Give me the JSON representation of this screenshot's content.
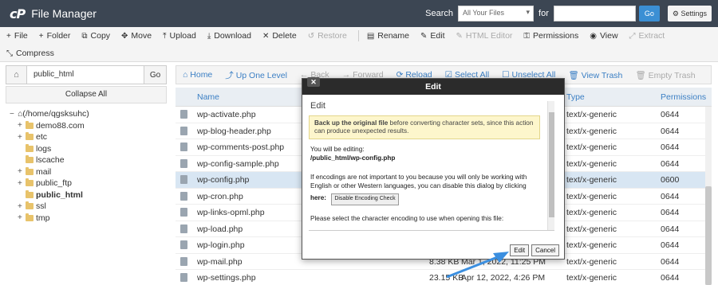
{
  "app": {
    "logo": "cP",
    "title": "File Manager"
  },
  "search": {
    "label": "Search",
    "scope": "All Your Files",
    "for_label": "for",
    "go": "Go",
    "settings": "Settings"
  },
  "toolbar": {
    "row1": [
      {
        "icon": "plus-icon",
        "glyph": "+",
        "label": "File"
      },
      {
        "icon": "plus-icon",
        "glyph": "+",
        "label": "Folder"
      },
      {
        "icon": "copy-icon",
        "glyph": "⧉",
        "label": "Copy"
      },
      {
        "icon": "move-icon",
        "glyph": "✥",
        "label": "Move"
      },
      {
        "icon": "upload-icon",
        "glyph": "⤒",
        "label": "Upload"
      },
      {
        "icon": "download-icon",
        "glyph": "⤓",
        "label": "Download"
      },
      {
        "icon": "delete-icon",
        "glyph": "✕",
        "label": "Delete"
      },
      {
        "icon": "restore-icon",
        "glyph": "↺",
        "label": "Restore",
        "disabled": true
      },
      {
        "icon": "rename-icon",
        "glyph": "▤",
        "label": "Rename"
      },
      {
        "icon": "edit-icon",
        "glyph": "✎",
        "label": "Edit"
      },
      {
        "icon": "html-editor-icon",
        "glyph": "✎",
        "label": "HTML Editor",
        "disabled": true
      },
      {
        "icon": "key-icon",
        "glyph": "⚿",
        "label": "Permissions"
      },
      {
        "icon": "eye-icon",
        "glyph": "◉",
        "label": "View"
      },
      {
        "icon": "extract-icon",
        "glyph": "⤢",
        "label": "Extract",
        "disabled": true
      }
    ],
    "row2": [
      {
        "icon": "compress-icon",
        "glyph": "⤡",
        "label": "Compress"
      }
    ]
  },
  "sidebar": {
    "path_value": "public_html",
    "go": "Go",
    "collapse": "Collapse All",
    "tree": [
      {
        "label": "(/home/qgsksuhc)",
        "toggle": "−",
        "indent": 0,
        "home": true
      },
      {
        "label": "demo88.com",
        "toggle": "+",
        "indent": 1
      },
      {
        "label": "etc",
        "toggle": "+",
        "indent": 1
      },
      {
        "label": "logs",
        "toggle": "",
        "indent": 1
      },
      {
        "label": "lscache",
        "toggle": "",
        "indent": 1
      },
      {
        "label": "mail",
        "toggle": "+",
        "indent": 1
      },
      {
        "label": "public_ftp",
        "toggle": "+",
        "indent": 1
      },
      {
        "label": "public_html",
        "toggle": "",
        "indent": 1,
        "bold": true
      },
      {
        "label": "ssl",
        "toggle": "+",
        "indent": 1
      },
      {
        "label": "tmp",
        "toggle": "+",
        "indent": 1
      }
    ]
  },
  "nav": [
    {
      "icon": "home-icon",
      "glyph": "⌂",
      "label": "Home"
    },
    {
      "icon": "up-level-icon",
      "glyph": "⤴",
      "label": "Up One Level"
    },
    {
      "icon": "back-icon",
      "glyph": "←",
      "label": "Back",
      "disabled": true
    },
    {
      "icon": "forward-icon",
      "glyph": "→",
      "label": "Forward",
      "disabled": true
    },
    {
      "icon": "reload-icon",
      "glyph": "⟳",
      "label": "Reload"
    },
    {
      "icon": "select-all-icon",
      "glyph": "☑",
      "label": "Select All"
    },
    {
      "icon": "unselect-all-icon",
      "glyph": "☐",
      "label": "Unselect All"
    },
    {
      "icon": "trash-icon",
      "glyph": "🗑",
      "label": "View Trash"
    },
    {
      "icon": "empty-trash-icon",
      "glyph": "🗑",
      "label": "Empty Trash",
      "disabled": true
    }
  ],
  "table": {
    "headers": {
      "name": "Name",
      "type": "Type",
      "permissions": "Permissions"
    },
    "rows": [
      {
        "name": "wp-activate.php",
        "size": "",
        "date": "",
        "type": "text/x-generic",
        "perms": "0644"
      },
      {
        "name": "wp-blog-header.php",
        "size": "",
        "date": "",
        "type": "text/x-generic",
        "perms": "0644"
      },
      {
        "name": "wp-comments-post.php",
        "size": "",
        "date": "",
        "type": "text/x-generic",
        "perms": "0644"
      },
      {
        "name": "wp-config-sample.php",
        "size": "",
        "date": "",
        "type": "text/x-generic",
        "perms": "0644"
      },
      {
        "name": "wp-config.php",
        "size": "",
        "date": "",
        "type": "text/x-generic",
        "perms": "0600",
        "selected": true
      },
      {
        "name": "wp-cron.php",
        "size": "",
        "date": "",
        "type": "text/x-generic",
        "perms": "0644"
      },
      {
        "name": "wp-links-opml.php",
        "size": "",
        "date": "",
        "type": "text/x-generic",
        "perms": "0644"
      },
      {
        "name": "wp-load.php",
        "size": "",
        "date": "",
        "type": "text/x-generic",
        "perms": "0644"
      },
      {
        "name": "wp-login.php",
        "size": "",
        "date": "",
        "type": "text/x-generic",
        "perms": "0644"
      },
      {
        "name": "wp-mail.php",
        "size": "8.38 KB",
        "date": "Mar 1, 2022, 11:25 PM",
        "type": "text/x-generic",
        "perms": "0644"
      },
      {
        "name": "wp-settings.php",
        "size": "23.15 KB",
        "date": "Apr 12, 2022, 4:26 PM",
        "type": "text/x-generic",
        "perms": "0644"
      }
    ]
  },
  "modal": {
    "close": "✕",
    "header": "Edit",
    "title": "Edit",
    "warning_bold": "Back up the original file",
    "warning_rest": " before converting character sets, since this action can produce unexpected results.",
    "editing_label": "You will be editing:",
    "editing_path": "/public_html/wp-config.php",
    "encoding_note": "If encodings are not important to you because you will only be working with English or other Western languages, you can disable this dialog by clicking",
    "here_label": "here:",
    "disable_button": "Disable Encoding Check",
    "select_note": "Please select the character encoding to use when opening this file:",
    "edit_button": "Edit",
    "cancel_button": "Cancel"
  }
}
